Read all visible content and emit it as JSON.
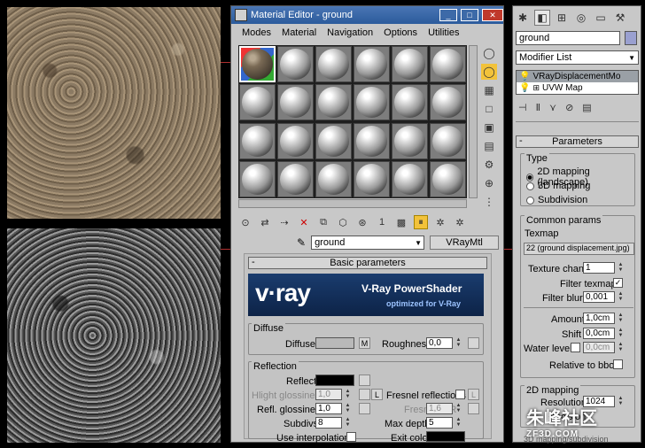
{
  "window": {
    "title": "Material Editor - ground",
    "min": "_",
    "max": "□",
    "close": "✕"
  },
  "menu": [
    "Modes",
    "Material",
    "Navigation",
    "Options",
    "Utilities"
  ],
  "material": {
    "name": "ground",
    "type": "VRayMtl"
  },
  "rollout": {
    "basic_title": "Basic parameters",
    "vray_logo": "v·ray",
    "vray_title": "V-Ray PowerShader",
    "vray_sub": "optimized for V-Ray",
    "diffuse": {
      "group": "Diffuse",
      "label": "Diffuse",
      "map_btn": "M",
      "roughness_label": "Roughness",
      "roughness": "0,0"
    },
    "reflection": {
      "group": "Reflection",
      "reflect_label": "Reflect",
      "hilight_label": "Hlight glossiness",
      "hilight": "1,0",
      "l_btn": "L",
      "fresnel_label": "Fresnel reflections",
      "fresnel_l": "L",
      "refl_gloss_label": "Refl. glossiness",
      "refl_gloss": "1,0",
      "fresnel_ior_label": "Fresnel IOR",
      "fresnel_ior": "1,6",
      "subdivs_label": "Subdivs",
      "subdivs": "8",
      "max_depth_label": "Max depth",
      "max_depth": "5",
      "interp_label": "Use interpolation",
      "exit_label": "Exit color"
    }
  },
  "right_panel": {
    "object_name": "ground",
    "modifier_list": "Modifier List",
    "stack": [
      {
        "label": "VRayDisplacementMo"
      },
      {
        "label": "UVW Map"
      }
    ],
    "params_title": "Parameters",
    "type_group": "Type",
    "types": [
      "2D mapping (landscape)",
      "3D mapping",
      "Subdivision"
    ],
    "selected_type": 0,
    "common_group": "Common params",
    "texmap_label": "Texmap",
    "texmap_value": "22 (ground displacement.jpg)",
    "texture_chan_label": "Texture chan",
    "texture_chan": "1",
    "filter_texmap_label": "Filter texmap",
    "filter_blur_label": "Filter blur",
    "filter_blur": "0,001",
    "amount_label": "Amount",
    "amount": "1,0cm",
    "shift_label": "Shift",
    "shift": "0,0cm",
    "water_label": "Water level",
    "water": "0,0cm",
    "rel_bbox_label": "Relative to bbox",
    "mapping2d_group": "2D mapping",
    "resolution_label": "Resolution",
    "resolution": "1024",
    "precision_label": "Precision",
    "mapping3d_group": "3D mapping/subdivision"
  },
  "watermark": {
    "main": "朱峰社区",
    "sub": "ZF3D.COM"
  },
  "colors": {
    "titlebar": "#2b5b9c",
    "vray_banner": "#1a3c6e",
    "accent_red": "#b03030"
  }
}
